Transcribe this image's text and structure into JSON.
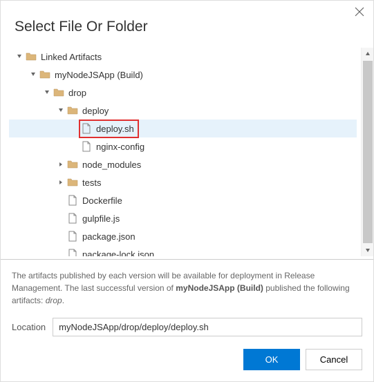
{
  "dialog": {
    "title": "Select File Or Folder",
    "close_icon": "close"
  },
  "tree": [
    {
      "depth": 0,
      "kind": "folder",
      "caret": "expanded",
      "label": "Linked Artifacts",
      "selected": false
    },
    {
      "depth": 1,
      "kind": "folder",
      "caret": "expanded",
      "label": "myNodeJSApp (Build)",
      "selected": false
    },
    {
      "depth": 2,
      "kind": "folder",
      "caret": "expanded",
      "label": "drop",
      "selected": false
    },
    {
      "depth": 3,
      "kind": "folder",
      "caret": "expanded",
      "label": "deploy",
      "selected": false
    },
    {
      "depth": 4,
      "kind": "file",
      "caret": "none",
      "label": "deploy.sh",
      "selected": true,
      "highlight": true
    },
    {
      "depth": 4,
      "kind": "file",
      "caret": "none",
      "label": "nginx-config",
      "selected": false
    },
    {
      "depth": 3,
      "kind": "folder",
      "caret": "collapsed",
      "label": "node_modules",
      "selected": false
    },
    {
      "depth": 3,
      "kind": "folder",
      "caret": "collapsed",
      "label": "tests",
      "selected": false
    },
    {
      "depth": 3,
      "kind": "file",
      "caret": "none",
      "label": "Dockerfile",
      "selected": false
    },
    {
      "depth": 3,
      "kind": "file",
      "caret": "none",
      "label": "gulpfile.js",
      "selected": false
    },
    {
      "depth": 3,
      "kind": "file",
      "caret": "none",
      "label": "package.json",
      "selected": false
    },
    {
      "depth": 3,
      "kind": "file",
      "caret": "none",
      "label": "package-lock.json",
      "selected": false
    }
  ],
  "description": {
    "text_before": "The artifacts published by each version will be available for deployment in Release Management. The last successful version of ",
    "bold_source": "myNodeJSApp (Build)",
    "text_mid": " published the following artifacts: ",
    "italic_artifact": "drop",
    "text_after": "."
  },
  "location": {
    "label": "Location",
    "value": "myNodeJSApp/drop/deploy/deploy.sh"
  },
  "buttons": {
    "ok": "OK",
    "cancel": "Cancel"
  }
}
